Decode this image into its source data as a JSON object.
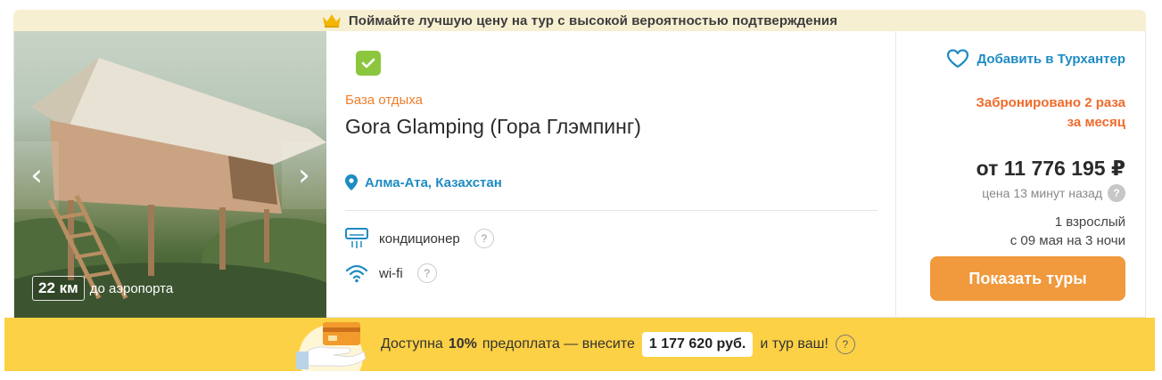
{
  "top_banner": {
    "text": "Поймайте лучшую цену на тур с высокой вероятностью подтверждения"
  },
  "photo": {
    "distance_value": "22 км",
    "distance_label": "до аэропорта"
  },
  "hotel": {
    "category": "База отдыха",
    "name": "Gora Glamping (Гора Глэмпинг)",
    "location": "Алма-Ата, Казахстан",
    "amenities": [
      {
        "label": "кондиционер",
        "icon": "air-conditioner-icon"
      },
      {
        "label": "wi-fi",
        "icon": "wifi-icon"
      }
    ]
  },
  "price_panel": {
    "favorite_label": "Добавить в Турхантер",
    "booked_line1": "Забронировано 2 раза",
    "booked_line2": "за месяц",
    "price": "от 11 776 195 ₽",
    "price_age": "цена 13 минут назад",
    "travelers": "1 взрослый",
    "dates": "с 09 мая на 3 ночи",
    "button_label": "Показать туры"
  },
  "prepay_banner": {
    "prefix": "Доступна",
    "percent": "10%",
    "middle": "предоплата — внесите",
    "amount": "1 177 620 руб.",
    "suffix": "и тур ваш!"
  },
  "colors": {
    "accent_blue": "#1e8bc3",
    "accent_orange": "#f0993d",
    "booked_orange": "#f06a2a",
    "banner_yellow": "#fdd145",
    "check_green": "#8cc63f"
  }
}
